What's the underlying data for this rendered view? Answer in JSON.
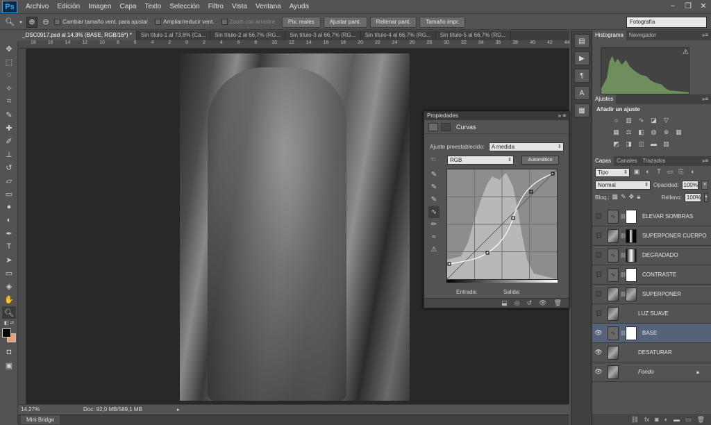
{
  "app": {
    "logo": "Ps"
  },
  "menu": [
    "Archivo",
    "Edición",
    "Imagen",
    "Capa",
    "Texto",
    "Selección",
    "Filtro",
    "Vista",
    "Ventana",
    "Ayuda"
  ],
  "window_controls": {
    "minimize": "−",
    "restore": "❐",
    "close": "✕"
  },
  "options_bar": {
    "resize_windows": "Cambiar tamaño vent. para ajustar",
    "zoom_all": "Ampliar/reducir vent.",
    "scrubby_zoom": "Zoom con arrastre",
    "actual_pixels": "Píx. reales",
    "fit_screen": "Ajustar pant.",
    "fill_screen": "Rellenar pant.",
    "print_size": "Tamaño impr.",
    "workspace": "Fotografía"
  },
  "tabs": [
    "_DSC0917.psd al 14,3% (BASE, RGB/16*) *",
    "Sin título-1 al 73,8% (Ca...",
    "Sin título-2 al 66,7% (RG...",
    "Sin título-3 al 66,7% (RG...",
    "Sin título-4 al 66,7% (RG...",
    "Sin título-5 al 66,7% (RG..."
  ],
  "ruler_ticks": [
    "18",
    "16",
    "14",
    "12",
    "10",
    "8",
    "6",
    "4",
    "2",
    "0",
    "2",
    "4",
    "6",
    "8",
    "10",
    "12",
    "14",
    "16",
    "18",
    "20",
    "22",
    "24",
    "26",
    "28",
    "30",
    "32",
    "34",
    "36",
    "38",
    "40",
    "42",
    "44"
  ],
  "status": {
    "zoom": "14,27%",
    "doc": "Doc: 92,0 MB/589,1 MB"
  },
  "minibridge": "Mini Bridge",
  "properties": {
    "header": "Propiedades",
    "type": "Curvas",
    "preset_label": "Ajuste preestablecido:",
    "preset_value": "A medida",
    "channel": "RGB",
    "auto": "Automático",
    "input_label": "Entrada:",
    "output_label": "Salida:"
  },
  "histogram_tabs": [
    "Histograma",
    "Navegador"
  ],
  "adjustments": {
    "tab": "Ajustes",
    "title": "Añadir un ajuste"
  },
  "layers_panel": {
    "tabs": [
      "Capas",
      "Canales",
      "Trazados"
    ],
    "filter": "Tipo",
    "blend_mode": "Normal",
    "opacity_label": "Opacidad:",
    "opacity": "100%",
    "lock_label": "Bloq.:",
    "fill_label": "Relleno:",
    "fill": "100%"
  },
  "layers": [
    {
      "name": "ELEVAR SOMBRAS",
      "visible": false,
      "thumb": "adj",
      "mask": "white",
      "selected": false
    },
    {
      "name": "SUPERPONER CUERPO",
      "visible": false,
      "thumb": "img",
      "mask": "dark",
      "selected": false
    },
    {
      "name": "DEGRADADO",
      "visible": false,
      "thumb": "adj",
      "mask": "grad",
      "selected": false
    },
    {
      "name": "CONTRASTE",
      "visible": false,
      "thumb": "adj",
      "mask": "white",
      "selected": false
    },
    {
      "name": "SUPERPONER",
      "visible": false,
      "thumb": "img",
      "mask": "img",
      "selected": false
    },
    {
      "name": "LUZ SUAVE",
      "visible": false,
      "thumb": "img",
      "mask": "",
      "selected": false
    },
    {
      "name": "BASE",
      "visible": true,
      "thumb": "adj",
      "mask": "white",
      "selected": true
    },
    {
      "name": "DESATURAR",
      "visible": true,
      "thumb": "img",
      "mask": "",
      "selected": false
    },
    {
      "name": "Fondo",
      "visible": true,
      "thumb": "img",
      "mask": "",
      "selected": false,
      "locked": true
    }
  ],
  "colors": {
    "foreground": "#000000",
    "background": "#e8a070",
    "selected_layer": "#54637a",
    "histogram": "#6e8e5e"
  }
}
